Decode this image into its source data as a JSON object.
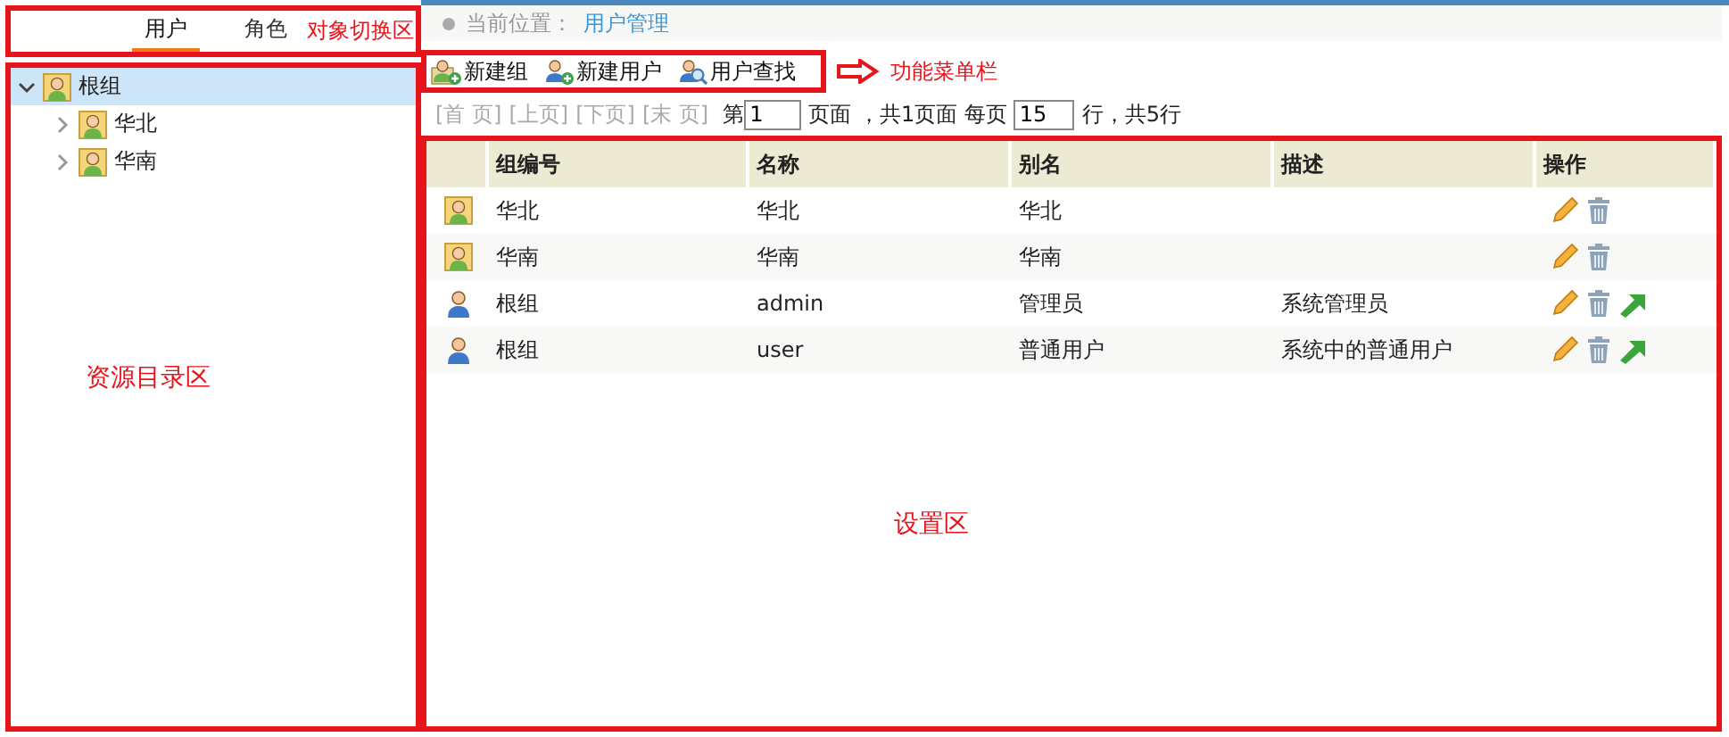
{
  "tabs": [
    {
      "label": "用户",
      "selected": true
    },
    {
      "label": "角色",
      "selected": false
    }
  ],
  "annotations": {
    "tabs": "对象切换区",
    "tree": "资源目录区",
    "toolbar": "功能菜单栏",
    "content": "设置区"
  },
  "tree": [
    {
      "label": "根组",
      "expanded": true,
      "selected": true,
      "children": [
        {
          "label": "华北",
          "expanded": false,
          "selected": false
        },
        {
          "label": "华南",
          "expanded": false,
          "selected": false
        }
      ]
    }
  ],
  "breadcrumb": {
    "label": "当前位置：",
    "current": "用户管理"
  },
  "toolbar": [
    {
      "label": "新建组",
      "kind": "new-group"
    },
    {
      "label": "新建用户",
      "kind": "new-user"
    },
    {
      "label": "用户查找",
      "kind": "find-user"
    }
  ],
  "pager": {
    "links": [
      {
        "label": "[首 页]",
        "disabled": true
      },
      {
        "label": "[上页]",
        "disabled": true
      },
      {
        "label": "[下页]",
        "disabled": true
      },
      {
        "label": "[末 页]",
        "disabled": true
      }
    ],
    "page_prefix": "第",
    "page": "1",
    "page_suffix": "页面 ，共1页面 每页",
    "per_page": "15",
    "rows_suffix": "行，共5行"
  },
  "table": {
    "columns": [
      "组编号",
      "名称",
      "别名",
      "描述",
      "操作"
    ],
    "rows": [
      {
        "kind": "group",
        "cells": [
          "华北",
          "华北",
          "华北",
          ""
        ],
        "actions": [
          {
            "kind": "edit"
          },
          {
            "kind": "delete"
          }
        ]
      },
      {
        "kind": "group",
        "cells": [
          "华南",
          "华南",
          "华南",
          ""
        ],
        "actions": [
          {
            "kind": "edit"
          },
          {
            "kind": "delete"
          }
        ]
      },
      {
        "kind": "user",
        "cells": [
          "根组",
          "admin",
          "管理员",
          "系统管理员"
        ],
        "actions": [
          {
            "kind": "edit"
          },
          {
            "kind": "delete"
          },
          {
            "kind": "move"
          }
        ]
      },
      {
        "kind": "user",
        "cells": [
          "根组",
          "user",
          "普通用户",
          "系统中的普通用户"
        ],
        "actions": [
          {
            "kind": "edit"
          },
          {
            "kind": "delete"
          },
          {
            "kind": "move"
          }
        ]
      }
    ]
  }
}
